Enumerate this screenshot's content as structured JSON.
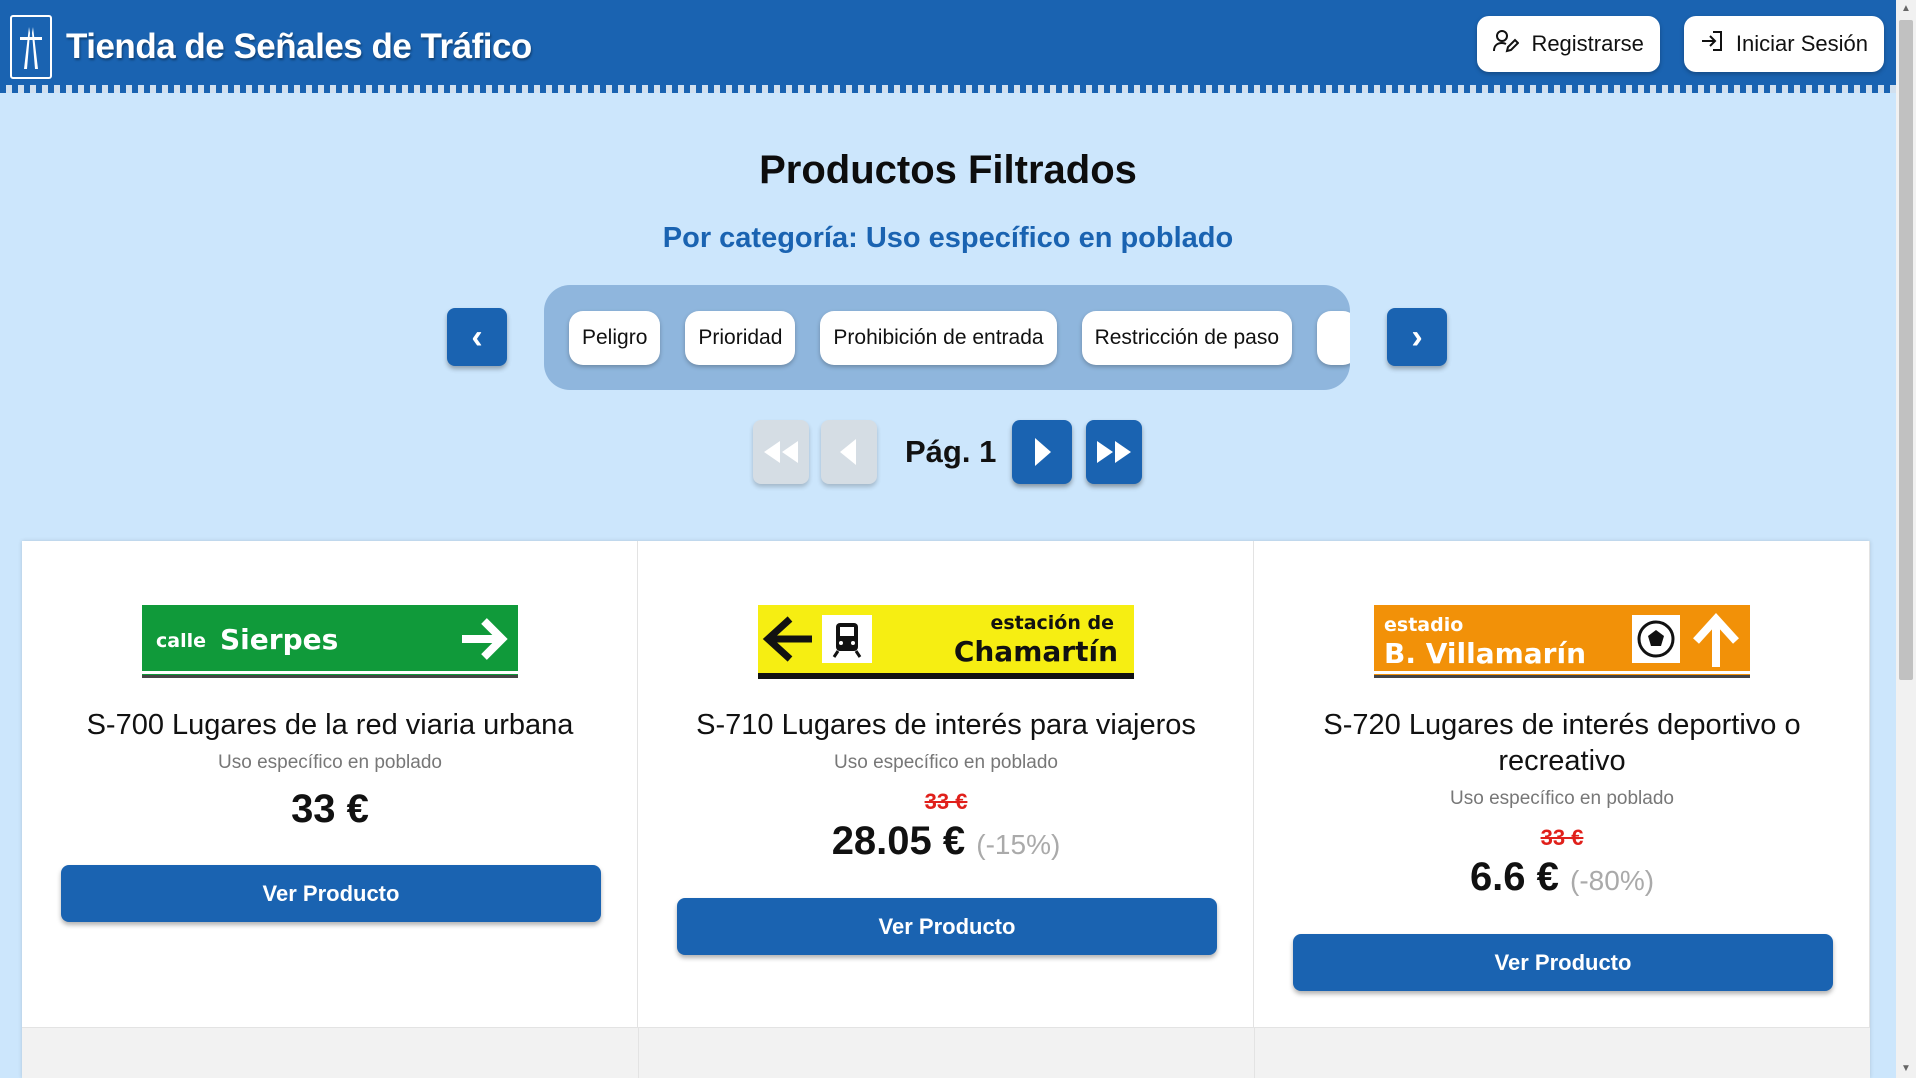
{
  "header": {
    "title": "Tienda de Señales de Tráfico",
    "register_label": "Registrarse",
    "login_label": "Iniciar Sesión",
    "color": "#1a63b1"
  },
  "main": {
    "title": "Productos Filtrados",
    "subtitle": "Por categoría: Uso específico en poblado"
  },
  "categories": [
    {
      "label": "Peligro"
    },
    {
      "label": "Prioridad"
    },
    {
      "label": "Prohibición de entrada"
    },
    {
      "label": "Restricción de paso"
    }
  ],
  "pagination": {
    "label": "Pág. 1"
  },
  "products": [
    {
      "name": "S-700 Lugares de la red viaria urbana",
      "category": "Uso específico en poblado",
      "price": "33 €",
      "old_price": "",
      "discount": "",
      "button": "Ver Producto",
      "sign": {
        "small": "calle",
        "big": "Sierpes",
        "bg": "#109a3a"
      }
    },
    {
      "name": "S-710 Lugares de interés para viajeros",
      "category": "Uso específico en poblado",
      "price": "28.05 €",
      "old_price": "33 €",
      "discount": "(-15%)",
      "button": "Ver Producto",
      "sign": {
        "small": "estación de",
        "big": "Chamartín",
        "bg": "#f6ee12"
      }
    },
    {
      "name": "S-720 Lugares de interés deportivo o recreativo",
      "category": "Uso específico en poblado",
      "price": "6.6 €",
      "old_price": "33 €",
      "discount": "(-80%)",
      "button": "Ver Producto",
      "sign": {
        "small": "estadio",
        "big": "B. Villamarín",
        "bg": "#f29108"
      }
    }
  ]
}
